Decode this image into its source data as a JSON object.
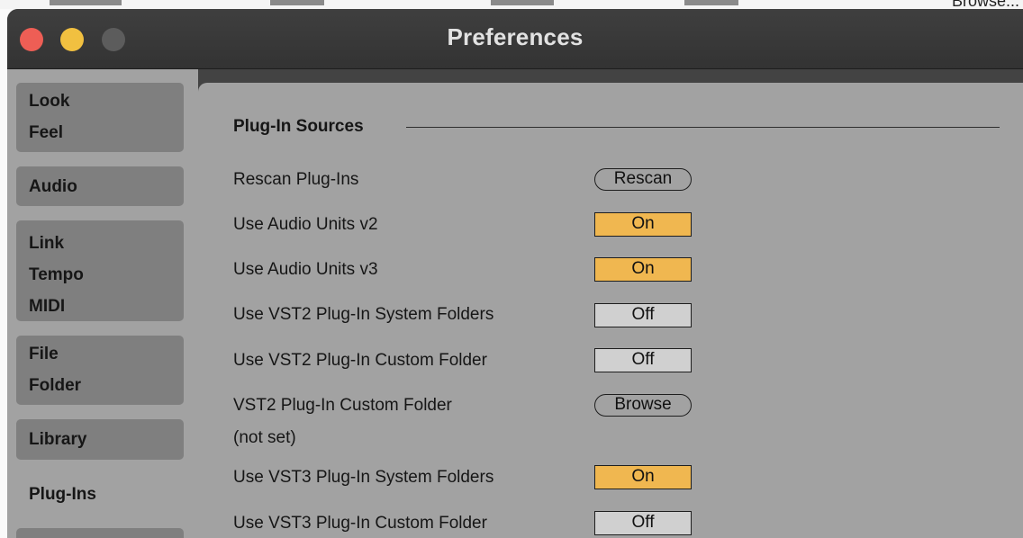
{
  "window": {
    "title": "Preferences",
    "background_strip_text": "Browse..."
  },
  "colors": {
    "toggle_on": "#f0b750",
    "toggle_off": "#d0d0d0",
    "panel": "#a2a2a2",
    "titlebar": "#3a3a3a",
    "close": "#ee5e55",
    "minimize": "#f1c040",
    "zoom_disabled": "#5c5c5c"
  },
  "sidebar": {
    "tabs": [
      {
        "lines": [
          "Look",
          "Feel"
        ]
      },
      {
        "lines": [
          "Audio"
        ]
      },
      {
        "lines": [
          "Link",
          "Tempo",
          "MIDI"
        ]
      },
      {
        "lines": [
          "File",
          "Folder"
        ]
      },
      {
        "lines": [
          "Library"
        ]
      },
      {
        "lines": [
          "Plug-Ins"
        ],
        "selected": true
      }
    ]
  },
  "content": {
    "section_title": "Plug-In Sources",
    "rows": [
      {
        "label": "Rescan Plug-Ins",
        "control": "button",
        "value": "Rescan"
      },
      {
        "label": "Use Audio Units v2",
        "control": "toggle",
        "value": "On"
      },
      {
        "label": "Use Audio Units v3",
        "control": "toggle",
        "value": "On"
      },
      {
        "label": "Use VST2 Plug-In System Folders",
        "control": "toggle",
        "value": "Off"
      },
      {
        "label": "Use VST2 Plug-In Custom Folder",
        "control": "toggle",
        "value": "Off"
      },
      {
        "label": "VST2 Plug-In Custom Folder",
        "sublabel": "(not set)",
        "control": "button",
        "value": "Browse"
      },
      {
        "label": "Use VST3 Plug-In System Folders",
        "control": "toggle",
        "value": "On"
      },
      {
        "label": "Use VST3 Plug-In Custom Folder",
        "control": "toggle",
        "value": "Off"
      }
    ]
  }
}
